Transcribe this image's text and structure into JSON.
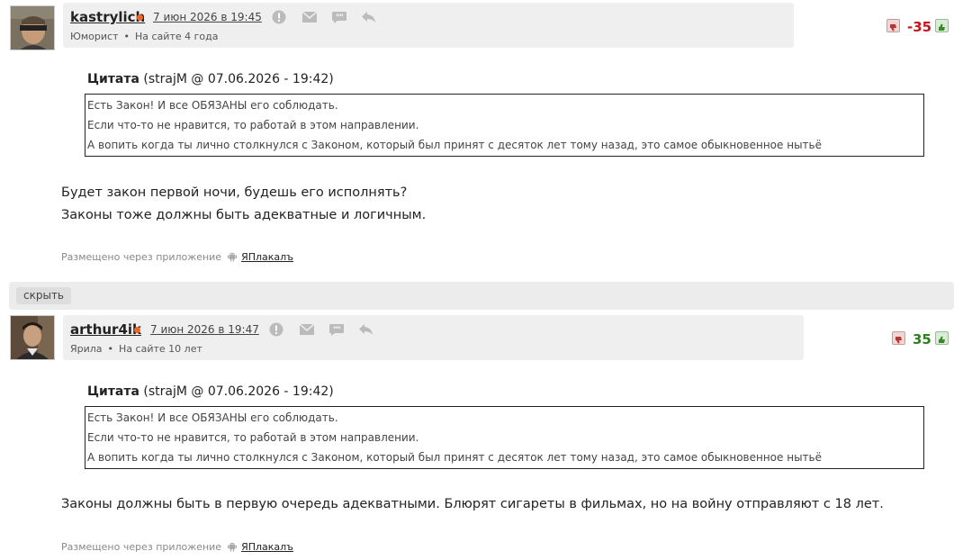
{
  "posts": [
    {
      "username": "kastrylich",
      "date": "7 июн 2026 в 19:45",
      "rank": "Юморист",
      "on_site": "На сайте 4 года",
      "rating": "-35",
      "rating_color": "#c4161c",
      "quote_title_label": "Цитата",
      "quote_title_meta": "(strajM @ 07.06.2026 - 19:42)",
      "quote_lines": [
        "Есть Закон! И все ОБЯЗАНЫ его соблюдать.",
        "Если что-то не нравится, то работай в этом направлении.",
        "А вопить когда ты лично столкнулся с Законом, который был принят с десяток лет тому назад, это самое обыкновенное нытьё"
      ],
      "body_lines": [
        "Будет закон первой ночи, будешь его исполнять?",
        "Законы тоже должны быть адекватные и логичным."
      ],
      "via_label": "Размещено через приложение",
      "via_app": "ЯПлакалъ"
    },
    {
      "username": "arthur4ik",
      "date": "7 июн 2026 в 19:47",
      "rank": "Ярила",
      "on_site": "На сайте 10 лет",
      "rating": "35",
      "rating_color": "#2e7d1e",
      "quote_title_label": "Цитата",
      "quote_title_meta": "(strajM @ 07.06.2026 - 19:42)",
      "quote_lines": [
        "Есть Закон! И все ОБЯЗАНЫ его соблюдать.",
        "Если что-то не нравится, то работай в этом направлении.",
        "А вопить когда ты лично столкнулся с Законом, который был принят с десяток лет тому назад, это самое обыкновенное нытьё"
      ],
      "body_lines": [
        "Законы должны быть в первую очередь адекватными. Блюрят сигареты в фильмах, но на войну отправляют с 18 лет."
      ],
      "via_label": "Размещено через приложение",
      "via_app": "ЯПлакалъ"
    }
  ],
  "hide_label": "скрыть",
  "icons": [
    "warning-icon",
    "envelope-icon",
    "quote-icon",
    "reply-icon",
    "thumb-down-icon",
    "thumb-up-icon",
    "android-icon"
  ]
}
